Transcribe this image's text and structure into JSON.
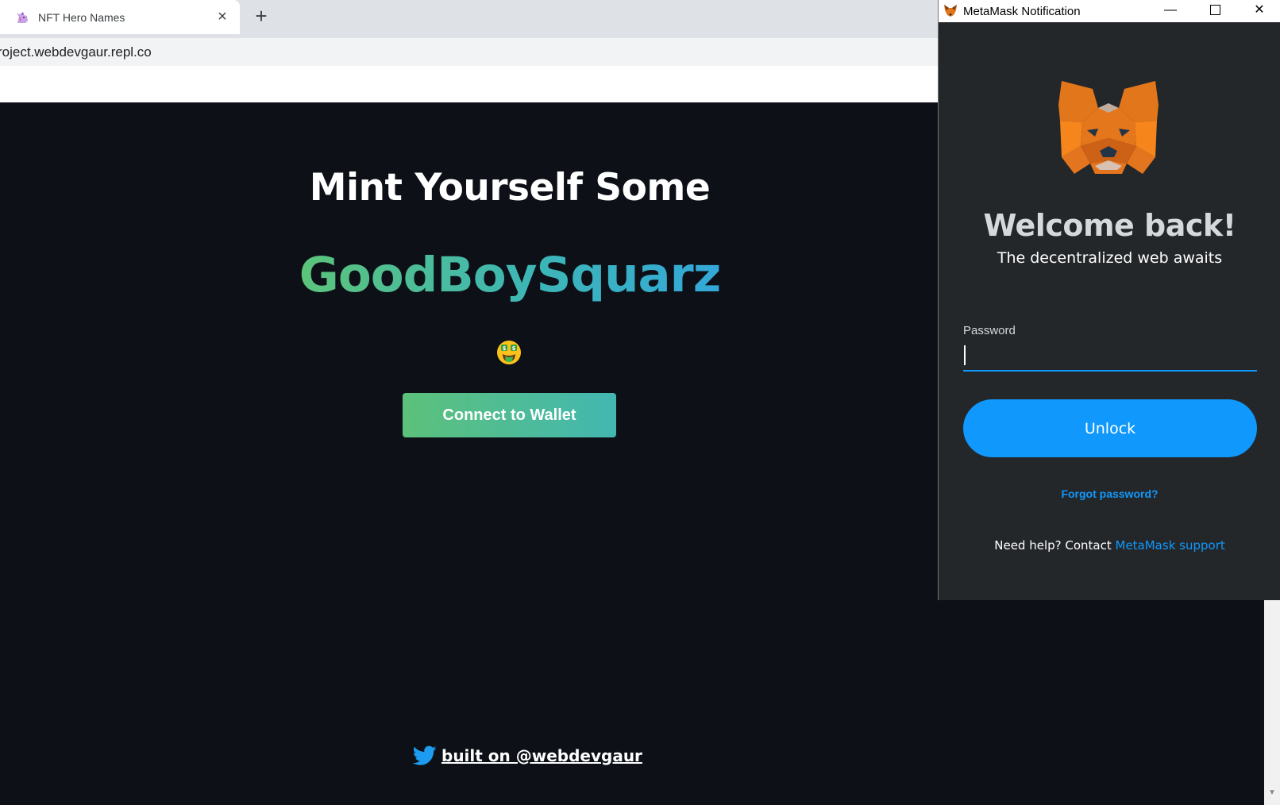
{
  "browser": {
    "tab": {
      "title": "NFT Hero Names",
      "close_glyph": "×",
      "favicon": "unicorn-icon"
    },
    "new_tab_glyph": "+",
    "address": "roject.webdevgaur.repl.co"
  },
  "page": {
    "headline": "Mint Yourself Some",
    "gradient_name": "GoodBoySquarz",
    "emoji_icon": "money-mouth-face-icon",
    "connect_button": "Connect to Wallet",
    "footer_text": "built on @webdevgaur",
    "footer_icon": "twitter-icon",
    "colors": {
      "background": "#0d1117",
      "gradient_start": "#5cc47a",
      "gradient_end": "#33a8d9",
      "twitter": "#1d9bf0"
    }
  },
  "metamask": {
    "window_title": "MetaMask Notification",
    "window_controls": {
      "minimize": "—",
      "close": "✕"
    },
    "welcome": "Welcome back!",
    "subtitle": "The decentralized web awaits",
    "password_label": "Password",
    "password_value": "",
    "unlock_button": "Unlock",
    "forgot_link": "Forgot password?",
    "help_prefix": "Need help? Contact ",
    "help_link": "MetaMask support",
    "colors": {
      "background": "#24272a",
      "accent": "#1098fc",
      "welcome_text": "#d6d9dc"
    }
  }
}
